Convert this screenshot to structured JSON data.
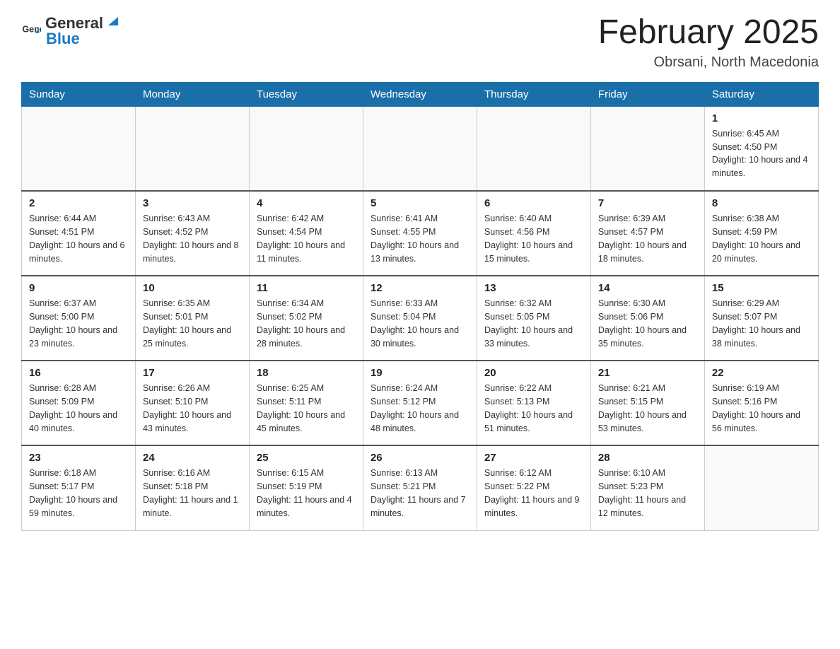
{
  "header": {
    "logo": {
      "text_general": "General",
      "text_blue": "Blue"
    },
    "month": "February 2025",
    "location": "Obrsani, North Macedonia"
  },
  "weekdays": [
    "Sunday",
    "Monday",
    "Tuesday",
    "Wednesday",
    "Thursday",
    "Friday",
    "Saturday"
  ],
  "weeks": [
    [
      {
        "day": "",
        "info": ""
      },
      {
        "day": "",
        "info": ""
      },
      {
        "day": "",
        "info": ""
      },
      {
        "day": "",
        "info": ""
      },
      {
        "day": "",
        "info": ""
      },
      {
        "day": "",
        "info": ""
      },
      {
        "day": "1",
        "info": "Sunrise: 6:45 AM\nSunset: 4:50 PM\nDaylight: 10 hours and 4 minutes."
      }
    ],
    [
      {
        "day": "2",
        "info": "Sunrise: 6:44 AM\nSunset: 4:51 PM\nDaylight: 10 hours and 6 minutes."
      },
      {
        "day": "3",
        "info": "Sunrise: 6:43 AM\nSunset: 4:52 PM\nDaylight: 10 hours and 8 minutes."
      },
      {
        "day": "4",
        "info": "Sunrise: 6:42 AM\nSunset: 4:54 PM\nDaylight: 10 hours and 11 minutes."
      },
      {
        "day": "5",
        "info": "Sunrise: 6:41 AM\nSunset: 4:55 PM\nDaylight: 10 hours and 13 minutes."
      },
      {
        "day": "6",
        "info": "Sunrise: 6:40 AM\nSunset: 4:56 PM\nDaylight: 10 hours and 15 minutes."
      },
      {
        "day": "7",
        "info": "Sunrise: 6:39 AM\nSunset: 4:57 PM\nDaylight: 10 hours and 18 minutes."
      },
      {
        "day": "8",
        "info": "Sunrise: 6:38 AM\nSunset: 4:59 PM\nDaylight: 10 hours and 20 minutes."
      }
    ],
    [
      {
        "day": "9",
        "info": "Sunrise: 6:37 AM\nSunset: 5:00 PM\nDaylight: 10 hours and 23 minutes."
      },
      {
        "day": "10",
        "info": "Sunrise: 6:35 AM\nSunset: 5:01 PM\nDaylight: 10 hours and 25 minutes."
      },
      {
        "day": "11",
        "info": "Sunrise: 6:34 AM\nSunset: 5:02 PM\nDaylight: 10 hours and 28 minutes."
      },
      {
        "day": "12",
        "info": "Sunrise: 6:33 AM\nSunset: 5:04 PM\nDaylight: 10 hours and 30 minutes."
      },
      {
        "day": "13",
        "info": "Sunrise: 6:32 AM\nSunset: 5:05 PM\nDaylight: 10 hours and 33 minutes."
      },
      {
        "day": "14",
        "info": "Sunrise: 6:30 AM\nSunset: 5:06 PM\nDaylight: 10 hours and 35 minutes."
      },
      {
        "day": "15",
        "info": "Sunrise: 6:29 AM\nSunset: 5:07 PM\nDaylight: 10 hours and 38 minutes."
      }
    ],
    [
      {
        "day": "16",
        "info": "Sunrise: 6:28 AM\nSunset: 5:09 PM\nDaylight: 10 hours and 40 minutes."
      },
      {
        "day": "17",
        "info": "Sunrise: 6:26 AM\nSunset: 5:10 PM\nDaylight: 10 hours and 43 minutes."
      },
      {
        "day": "18",
        "info": "Sunrise: 6:25 AM\nSunset: 5:11 PM\nDaylight: 10 hours and 45 minutes."
      },
      {
        "day": "19",
        "info": "Sunrise: 6:24 AM\nSunset: 5:12 PM\nDaylight: 10 hours and 48 minutes."
      },
      {
        "day": "20",
        "info": "Sunrise: 6:22 AM\nSunset: 5:13 PM\nDaylight: 10 hours and 51 minutes."
      },
      {
        "day": "21",
        "info": "Sunrise: 6:21 AM\nSunset: 5:15 PM\nDaylight: 10 hours and 53 minutes."
      },
      {
        "day": "22",
        "info": "Sunrise: 6:19 AM\nSunset: 5:16 PM\nDaylight: 10 hours and 56 minutes."
      }
    ],
    [
      {
        "day": "23",
        "info": "Sunrise: 6:18 AM\nSunset: 5:17 PM\nDaylight: 10 hours and 59 minutes."
      },
      {
        "day": "24",
        "info": "Sunrise: 6:16 AM\nSunset: 5:18 PM\nDaylight: 11 hours and 1 minute."
      },
      {
        "day": "25",
        "info": "Sunrise: 6:15 AM\nSunset: 5:19 PM\nDaylight: 11 hours and 4 minutes."
      },
      {
        "day": "26",
        "info": "Sunrise: 6:13 AM\nSunset: 5:21 PM\nDaylight: 11 hours and 7 minutes."
      },
      {
        "day": "27",
        "info": "Sunrise: 6:12 AM\nSunset: 5:22 PM\nDaylight: 11 hours and 9 minutes."
      },
      {
        "day": "28",
        "info": "Sunrise: 6:10 AM\nSunset: 5:23 PM\nDaylight: 11 hours and 12 minutes."
      },
      {
        "day": "",
        "info": ""
      }
    ]
  ]
}
